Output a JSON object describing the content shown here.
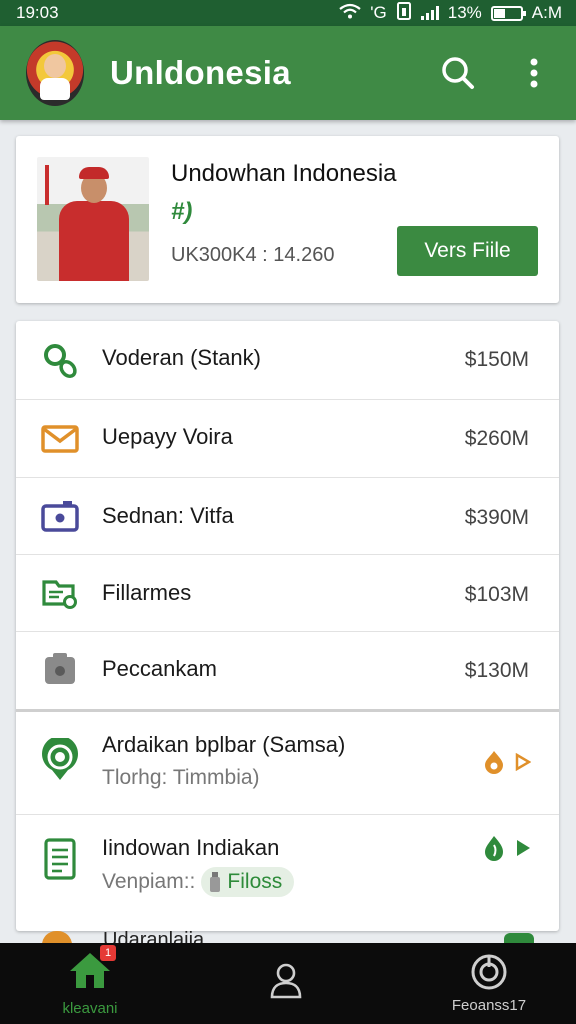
{
  "status_bar": {
    "time": "19:03",
    "network": "'G",
    "battery": "13%",
    "clock_right": "A:M"
  },
  "app_bar": {
    "title": "Unldonesia"
  },
  "profile": {
    "name": "Undowhan Indonesia",
    "tag": "#)",
    "code": "UK300K4 : 14.260",
    "button_label": "Vers Fiile"
  },
  "accounts": [
    {
      "icon": "search-leaf-icon",
      "label": "Voderan (Stank)",
      "amount": "$150M",
      "color": "#2f8a3c"
    },
    {
      "icon": "mail-icon",
      "label": "Uepayy Voira",
      "amount": "$260M",
      "color": "#e0902a"
    },
    {
      "icon": "camera-icon",
      "label": "Sednan: Vitfa",
      "amount": "$390M",
      "color": "#4a4a9a"
    },
    {
      "icon": "folder-icon",
      "label": "Fillarmes",
      "amount": "$103M",
      "color": "#2f8a3c"
    },
    {
      "icon": "gallery-icon",
      "label": "Peccankam",
      "amount": "$130M",
      "color": "#7a7a7a"
    }
  ],
  "activities": [
    {
      "icon": "location-icon",
      "title": "Ardaikan bplbar (Samsa)",
      "subtitle": "Tlorhg: Timmbia)",
      "chip": ""
    },
    {
      "icon": "document-icon",
      "title": "Iindowan Indiakan",
      "subtitle": "Venpiam::",
      "chip": "Filoss"
    }
  ],
  "peek_row": {
    "title": "Udaranlaiia"
  },
  "bottom_nav": {
    "items": [
      {
        "label": "kleavani",
        "badge": "1"
      },
      {
        "label": ""
      },
      {
        "label": "Feoanss17"
      }
    ]
  },
  "colors": {
    "primary": "#3f8a45",
    "status_bar": "#1f5f31",
    "accent_orange": "#e0902a"
  }
}
